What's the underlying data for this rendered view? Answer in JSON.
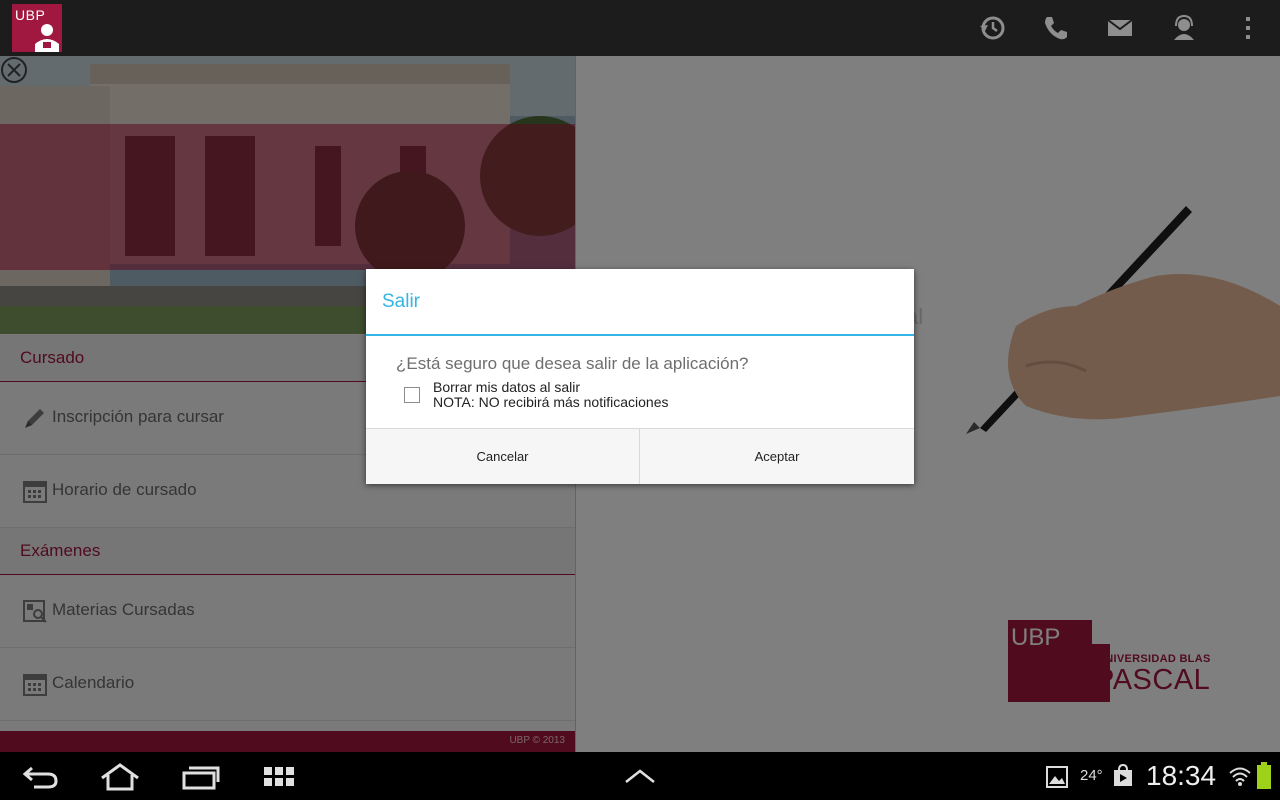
{
  "topbar": {
    "logo_text": "UBP",
    "icons": [
      "history-icon",
      "phone-icon",
      "mail-icon",
      "support-agent-icon",
      "overflow-menu-icon"
    ]
  },
  "sidebar": {
    "close_icon": "close-circle-icon",
    "sections": [
      {
        "title": "Cursado",
        "items": [
          {
            "label": "Inscripción para cursar",
            "icon": "pencil-icon"
          },
          {
            "label": "Horario de cursado",
            "icon": "calendar-icon"
          }
        ]
      },
      {
        "title": "Exámenes",
        "items": [
          {
            "label": "Materias Cursadas",
            "icon": "document-search-icon"
          },
          {
            "label": "Calendario",
            "icon": "calendar-icon"
          }
        ]
      }
    ],
    "footer": "UBP © 2013"
  },
  "background": {
    "partial_text": "al",
    "brand_logo_text": "UBP",
    "brand_line1": "UNIVERSIDAD BLAS",
    "brand_line2": "PASCAL"
  },
  "dialog": {
    "title": "Salir",
    "message": "¿Está seguro que desea salir de la aplicación?",
    "checkbox_line1": "Borrar mis datos al salir",
    "checkbox_line2": "NOTA: NO recibirá más notificaciones",
    "checkbox_checked": false,
    "cancel_label": "Cancelar",
    "accept_label": "Aceptar"
  },
  "system_bar": {
    "temperature": "24°",
    "time": "18:34",
    "icons": [
      "back-icon",
      "home-icon",
      "recent-apps-icon",
      "apps-grid-icon",
      "chevron-up-icon",
      "gallery-icon",
      "play-store-icon",
      "wifi-icon",
      "battery-icon"
    ]
  },
  "colors": {
    "brand": "#a0173f",
    "dialog_accent": "#33b5e5"
  }
}
